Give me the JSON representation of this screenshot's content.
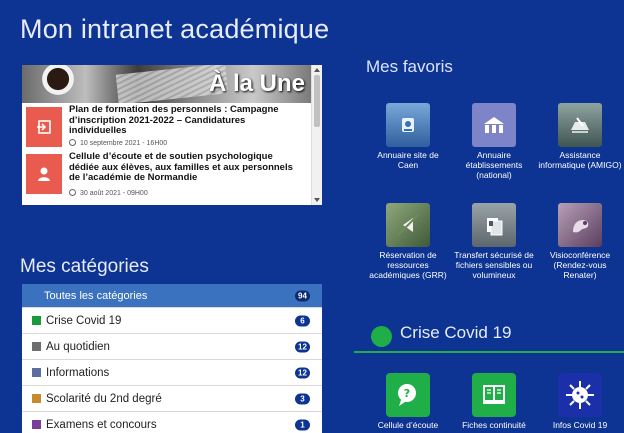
{
  "page": {
    "title": "Mon intranet académique"
  },
  "news": {
    "banner_title": "À la Une",
    "items": [
      {
        "title": "Plan de formation des personnels : Campagne d’inscription 2021-2022 – Candidatures individuelles",
        "date": "10 septembre 2021 - 16H00"
      },
      {
        "title": "Cellule d’écoute et de soutien psychologique dédiée aux élèves, aux familles et aux personnels de l’académie de Normandie",
        "date": "30 août 2021 - 09H00"
      }
    ]
  },
  "categories": {
    "title": "Mes catégories",
    "items": [
      {
        "label": "Toutes les catégories",
        "count": "94",
        "color": ""
      },
      {
        "label": "Crise Covid 19",
        "count": "6",
        "color": "#1a9a3b"
      },
      {
        "label": "Au quotidien",
        "count": "12",
        "color": "#6e6e6e"
      },
      {
        "label": "Informations",
        "count": "12",
        "color": "#5a6ea0"
      },
      {
        "label": "Scolarité du 2nd degré",
        "count": "3",
        "color": "#c9892d"
      },
      {
        "label": "Examens et concours",
        "count": "1",
        "color": "#7b3f99"
      }
    ]
  },
  "favorites": {
    "title": "Mes favoris",
    "items": [
      {
        "label": "Annuaire site de Caen",
        "icon": "directory-caen-icon"
      },
      {
        "label": "Annuaire établissements (national)",
        "icon": "school-building-icon"
      },
      {
        "label": "Assistance informatique (AMIGO)",
        "icon": "it-support-icon"
      },
      {
        "label": "Réservation de ressources académiques (GRR)",
        "icon": "reservation-icon"
      },
      {
        "label": "Transfert sécurisé de fichiers sensibles ou volumineux",
        "icon": "file-transfer-icon"
      },
      {
        "label": "Visioconférence (Rendez-vous Renater)",
        "icon": "videoconference-icon"
      }
    ]
  },
  "covid": {
    "title": "Crise Covid 19",
    "items": [
      {
        "label": "Cellule d’écoute",
        "icon": "chat-help-icon",
        "color": "#1fae48"
      },
      {
        "label": "Fiches continuité",
        "icon": "book-icon",
        "color": "#1fae48"
      },
      {
        "label": "Infos Covid 19",
        "icon": "virus-icon",
        "color": "#1b2fa8"
      }
    ]
  }
}
